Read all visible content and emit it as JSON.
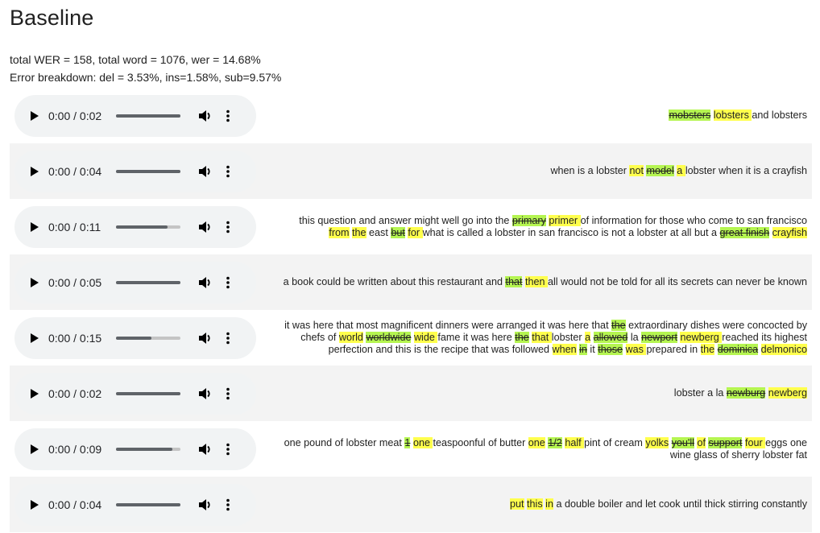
{
  "page": {
    "title": "Baseline",
    "summary_line": "total WER = 158, total word = 1076, wer = 14.68%",
    "breakdown_line": "Error breakdown: del = 3.53%, ins=1.58%, sub=9.57%"
  },
  "colors": {
    "inserted_highlight": "#ffff4d",
    "deleted_highlight": "#b5f551",
    "alt_row_background": "#f3f3f3",
    "player_background": "#f1f3f4"
  },
  "icons": {
    "play": "play-icon",
    "volume": "volume-icon",
    "more": "more-options-icon"
  },
  "rows": [
    {
      "time": "0:00 / 0:02",
      "buffered": 1.0,
      "lines": [
        [
          {
            "t": "mobsters",
            "k": "del"
          },
          {
            "t": " "
          },
          {
            "t": "lobsters ",
            "k": "ins"
          },
          {
            "t": "and lobsters"
          }
        ]
      ]
    },
    {
      "time": "0:00 / 0:04",
      "buffered": 1.0,
      "lines": [
        [
          {
            "t": "when is a lobster "
          },
          {
            "t": "not",
            "k": "ins"
          },
          {
            "t": " "
          },
          {
            "t": "model",
            "k": "del"
          },
          {
            "t": " "
          },
          {
            "t": "a ",
            "k": "ins"
          },
          {
            "t": "lobster when it is a crayfish"
          }
        ]
      ]
    },
    {
      "time": "0:00 / 0:11",
      "buffered": 0.8,
      "lines": [
        [
          {
            "t": "this question and answer might well go into the "
          },
          {
            "t": "primary",
            "k": "del"
          },
          {
            "t": " "
          },
          {
            "t": "primer ",
            "k": "ins"
          },
          {
            "t": "of information for those who come to san francisco"
          }
        ],
        [
          {
            "t": "from",
            "k": "ins"
          },
          {
            "t": " "
          },
          {
            "t": "the",
            "k": "ins"
          },
          {
            "t": " east "
          },
          {
            "t": "but",
            "k": "del"
          },
          {
            "t": " "
          },
          {
            "t": "for ",
            "k": "ins"
          },
          {
            "t": "what is called a lobster in san francisco is not a lobster at all but a "
          },
          {
            "t": "great finish",
            "k": "del"
          },
          {
            "t": " "
          },
          {
            "t": "crayfish",
            "k": "ins"
          }
        ]
      ]
    },
    {
      "time": "0:00 / 0:05",
      "buffered": 1.0,
      "lines": [
        [
          {
            "t": "a book could be written about this restaurant and "
          },
          {
            "t": "that",
            "k": "del"
          },
          {
            "t": " "
          },
          {
            "t": "then ",
            "k": "ins"
          },
          {
            "t": "all would not be told for all its secrets can never be known"
          }
        ]
      ]
    },
    {
      "time": "0:00 / 0:15",
      "buffered": 0.55,
      "lines": [
        [
          {
            "t": "it was here that most magnificent dinners were arranged it was here that "
          },
          {
            "t": "the",
            "k": "del"
          },
          {
            "t": " extraordinary dishes were concocted by"
          }
        ],
        [
          {
            "t": "chefs of "
          },
          {
            "t": "world",
            "k": "ins"
          },
          {
            "t": " "
          },
          {
            "t": "worldwide",
            "k": "del"
          },
          {
            "t": " "
          },
          {
            "t": "wide ",
            "k": "ins"
          },
          {
            "t": "fame it was here "
          },
          {
            "t": "the",
            "k": "del"
          },
          {
            "t": " "
          },
          {
            "t": "that ",
            "k": "ins"
          },
          {
            "t": "lobster "
          },
          {
            "t": "a",
            "k": "ins"
          },
          {
            "t": " "
          },
          {
            "t": "allowed",
            "k": "del"
          },
          {
            "t": " la "
          },
          {
            "t": "newport",
            "k": "del"
          },
          {
            "t": " "
          },
          {
            "t": "newberg ",
            "k": "ins"
          },
          {
            "t": "reached its highest"
          }
        ],
        [
          {
            "t": "perfection and this is the recipe that was followed "
          },
          {
            "t": "when",
            "k": "ins"
          },
          {
            "t": " "
          },
          {
            "t": "in",
            "k": "del"
          },
          {
            "t": " it "
          },
          {
            "t": "those",
            "k": "del"
          },
          {
            "t": " "
          },
          {
            "t": "was ",
            "k": "ins"
          },
          {
            "t": "prepared in "
          },
          {
            "t": "the",
            "k": "ins"
          },
          {
            "t": " "
          },
          {
            "t": "dominica",
            "k": "del"
          },
          {
            "t": " "
          },
          {
            "t": "delmonico",
            "k": "ins"
          }
        ]
      ]
    },
    {
      "time": "0:00 / 0:02",
      "buffered": 1.0,
      "lines": [
        [
          {
            "t": "lobster a la "
          },
          {
            "t": "newburg",
            "k": "del"
          },
          {
            "t": " "
          },
          {
            "t": "newberg",
            "k": "ins"
          }
        ]
      ]
    },
    {
      "time": "0:00 / 0:09",
      "buffered": 0.88,
      "lines": [
        [
          {
            "t": "one pound of lobster meat "
          },
          {
            "t": "1",
            "k": "del"
          },
          {
            "t": " "
          },
          {
            "t": "one ",
            "k": "ins"
          },
          {
            "t": "teaspoonful of butter "
          },
          {
            "t": "one",
            "k": "ins"
          },
          {
            "t": " "
          },
          {
            "t": "1/2",
            "k": "del"
          },
          {
            "t": " "
          },
          {
            "t": "half ",
            "k": "ins"
          },
          {
            "t": "pint of cream "
          },
          {
            "t": "yolks",
            "k": "ins"
          },
          {
            "t": " "
          },
          {
            "t": "you'll",
            "k": "del"
          },
          {
            "t": " "
          },
          {
            "t": "of",
            "k": "ins"
          },
          {
            "t": " "
          },
          {
            "t": "support",
            "k": "del"
          },
          {
            "t": " "
          },
          {
            "t": "four ",
            "k": "ins"
          },
          {
            "t": "eggs one"
          }
        ],
        [
          {
            "t": "wine glass of sherry lobster fat"
          }
        ]
      ]
    },
    {
      "time": "0:00 / 0:04",
      "buffered": 1.0,
      "lines": [
        [
          {
            "t": "put",
            "k": "ins"
          },
          {
            "t": " "
          },
          {
            "t": "this",
            "k": "ins"
          },
          {
            "t": " "
          },
          {
            "t": "in",
            "k": "ins"
          },
          {
            "t": " a double boiler and let cook until thick stirring constantly"
          }
        ]
      ]
    }
  ]
}
